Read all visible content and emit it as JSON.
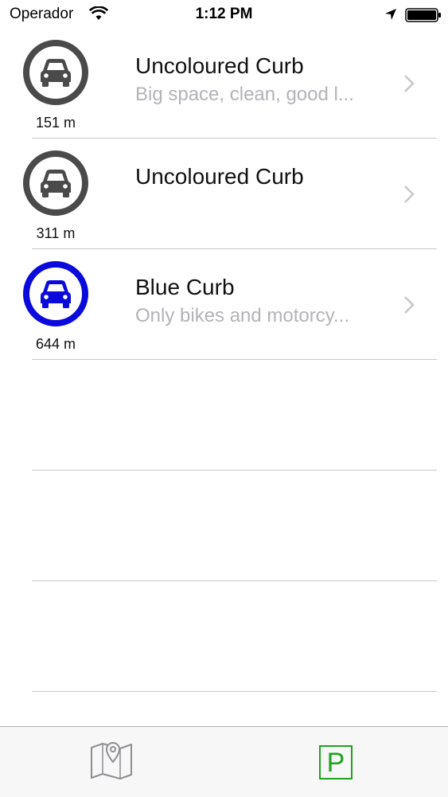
{
  "status_bar": {
    "carrier": "Operador",
    "time": "1:12 PM"
  },
  "spots": [
    {
      "title": "Uncoloured Curb",
      "subtitle": "Big space, clean, good l...",
      "distance": "151 m",
      "badge_color": "#4a4a4a"
    },
    {
      "title": "Uncoloured Curb",
      "subtitle": "",
      "distance": "311 m",
      "badge_color": "#4a4a4a"
    },
    {
      "title": "Blue Curb",
      "subtitle": "Only bikes and motorcy...",
      "distance": "644 m",
      "badge_color": "#0a0adc"
    }
  ],
  "tab_bar": {
    "tabs": [
      {
        "icon": "map-pin-icon",
        "selected": false
      },
      {
        "icon": "parking-icon",
        "label": "P",
        "selected": true,
        "color": "#1fa31f"
      }
    ]
  },
  "colors": {
    "separator": "#c8c7cc",
    "subtitle": "#b3b3b8",
    "chevron": "#c7c7cc",
    "accent": "#1fa31f"
  }
}
